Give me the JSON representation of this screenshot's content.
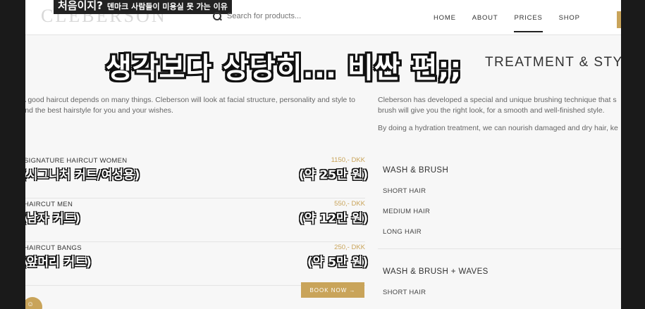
{
  "overlay_top": {
    "main": "처음이지?",
    "sub": "덴마크 사람들이 미용실 못 가는 이유"
  },
  "header": {
    "logo": "CLEBERSON",
    "search_placeholder": "Search for products...",
    "nav": [
      "HOME",
      "ABOUT",
      "PRICES",
      "SHOP"
    ],
    "active_nav": "PRICES"
  },
  "caption": "생각보다 상당히... 비싼 편;;",
  "section_heading": "TREATMENT & STYLE",
  "intro_left": "A good haircut depends on many things. Cleberson will look at facial structure, personality and style to find the best hairstyle for you and your wishes.",
  "intro_right": [
    "Cleberson has developed a special and unique brushing technique that s",
    "brush will give you the right look, for a smooth and well-finished style.",
    "By doing a hydration treatment, we can nourish damaged and dry hair, ke"
  ],
  "prices": [
    {
      "service": "SIGNATURE HAIRCUT WOMEN",
      "price": "1150,- DKK",
      "ko": "(시그니처 커트/여성용)",
      "ko_price": "(약 25만 원)"
    },
    {
      "service": "HAIRCUT MEN",
      "price": "550,- DKK",
      "ko": "(남자 커트)",
      "ko_price": "(약 12만 원)"
    },
    {
      "service": "HAIRCUT BANGS",
      "price": "250,- DKK",
      "ko": "(앞머리 커트)",
      "ko_price": "(약 5만 원)"
    }
  ],
  "book_button": "BOOK NOW →",
  "right_groups": [
    {
      "title": "WASH & BRUSH",
      "items": [
        "SHORT HAIR",
        "MEDIUM HAIR",
        "LONG HAIR"
      ]
    },
    {
      "title": "WASH & BRUSH + WAVES",
      "items": [
        "SHORT HAIR"
      ]
    }
  ],
  "colors": {
    "accent": "#c9a45a",
    "text": "#333333",
    "bg": "#f7f7f7"
  }
}
